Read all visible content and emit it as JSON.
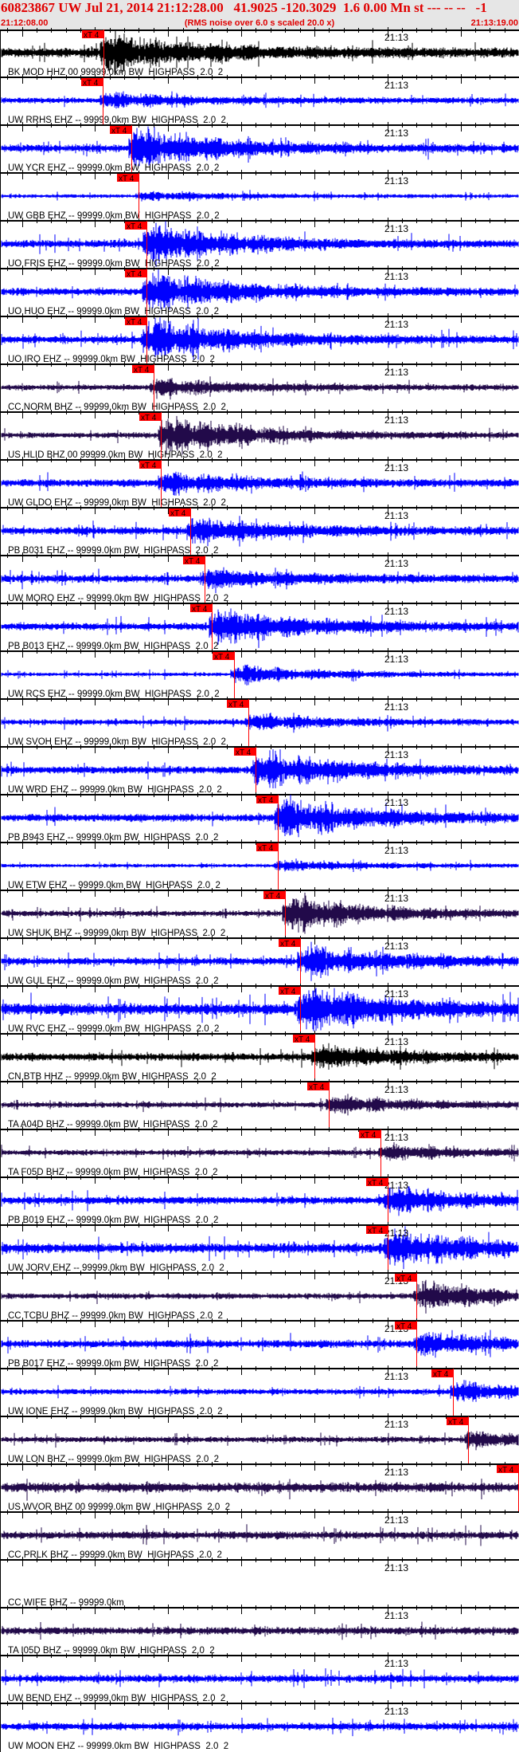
{
  "header": {
    "title": "60823867 UW Jul 21, 2014 21:12:28.00   41.9025 -120.3029  1.6 0.00 Mn st --- -- --   -1",
    "start_time": "21:12:08.00",
    "end_time": "21:13:19.00",
    "note": "(RMS noise over 6.0 s scaled 20.0 x)"
  },
  "time_axis": {
    "span_s": 71,
    "major_label": "21:13",
    "major_label_s": 52
  },
  "pick_label": "xT 4",
  "colors": {
    "header_text": "#e00000",
    "pick": "#ff0000",
    "header_bg": "#e6e6e6"
  },
  "traces": [
    {
      "label": "BK MOD HHZ 00 99999.0km BW  HIGHPASS  2.0  2",
      "color": "#000000",
      "pick_s": 14.2,
      "noise": 5,
      "amp": 28
    },
    {
      "label": "UW RRHS EHZ -- 99999.0km BW  HIGHPASS  2.0  2",
      "color": "#0000ff",
      "pick_s": 14.1,
      "noise": 3,
      "amp": 10
    },
    {
      "label": "UW YCR EHZ -- 99999.0km BW  HIGHPASS  2.0  2",
      "color": "#0000ff",
      "pick_s": 18.0,
      "noise": 4,
      "amp": 30
    },
    {
      "label": "UW GBB EHZ -- 99999.0km BW  HIGHPASS  2.0  2",
      "color": "#0000ff",
      "pick_s": 19.0,
      "noise": 2,
      "amp": 6
    },
    {
      "label": "UO FRIS EHZ -- 99999.0km BW  HIGHPASS  2.0  2",
      "color": "#0000ff",
      "pick_s": 20.0,
      "noise": 4,
      "amp": 30
    },
    {
      "label": "UO HUO EHZ -- 99999.0km BW  HIGHPASS  2.0  2",
      "color": "#0000ff",
      "pick_s": 20.0,
      "noise": 4,
      "amp": 30
    },
    {
      "label": "UO IRO EHZ -- 99999.0km BW  HIGHPASS  2.0  2",
      "color": "#0000ff",
      "pick_s": 20.0,
      "noise": 4,
      "amp": 30
    },
    {
      "label": "CC NORM BHZ -- 99999.0km BW  HIGHPASS  2.0  2",
      "color": "#220a4a",
      "pick_s": 21.0,
      "noise": 3,
      "amp": 12
    },
    {
      "label": "US HLID BHZ 00 99999.0km BW  HIGHPASS  2.0  2",
      "color": "#220a4a",
      "pick_s": 22.0,
      "noise": 3,
      "amp": 30
    },
    {
      "label": "UW GLDO EHZ -- 99999.0km BW  HIGHPASS  2.0  2",
      "color": "#0000ff",
      "pick_s": 22.0,
      "noise": 4,
      "amp": 14
    },
    {
      "label": "PB B031 EHZ -- 99999.0km BW  HIGHPASS  2.0  2",
      "color": "#0000ff",
      "pick_s": 26.0,
      "noise": 4,
      "amp": 18
    },
    {
      "label": "UW MORO EHZ -- 99999.0km BW  HIGHPASS  2.0  2",
      "color": "#0000ff",
      "pick_s": 28.0,
      "noise": 4,
      "amp": 14
    },
    {
      "label": "PB B013 EHZ -- 99999.0km BW  HIGHPASS  2.0  2",
      "color": "#0000ff",
      "pick_s": 29.0,
      "noise": 4,
      "amp": 28
    },
    {
      "label": "UW RCS EHZ -- 99999.0km BW  HIGHPASS  2.0  2",
      "color": "#0000ff",
      "pick_s": 32.0,
      "noise": 2,
      "amp": 14
    },
    {
      "label": "UW SVOH EHZ -- 99999.0km BW  HIGHPASS  2.0  2",
      "color": "#0000ff",
      "pick_s": 34.0,
      "noise": 3,
      "amp": 10
    },
    {
      "label": "UW WRD EHZ -- 99999.0km BW  HIGHPASS  2.0  2",
      "color": "#0000ff",
      "pick_s": 35.0,
      "noise": 4,
      "amp": 28
    },
    {
      "label": "PB B943 EHZ -- 99999.0km BW  HIGHPASS  2.0  2",
      "color": "#0000ff",
      "pick_s": 38.0,
      "noise": 4,
      "amp": 30
    },
    {
      "label": "UW ETW EHZ -- 99999.0km BW  HIGHPASS  2.0  2",
      "color": "#0000ff",
      "pick_s": 38.0,
      "noise": 2,
      "amp": 8
    },
    {
      "label": "UW SHUK BHZ -- 99999.0km BW  HIGHPASS  2.0  2",
      "color": "#220a4a",
      "pick_s": 39.0,
      "noise": 3,
      "amp": 28
    },
    {
      "label": "UW GUL EHZ -- 99999.0km BW  HIGHPASS  2.0  2",
      "color": "#0000ff",
      "pick_s": 41.1,
      "noise": 4,
      "amp": 24
    },
    {
      "label": "UW RVC EHZ -- 99999.0km BW  HIGHPASS  2.0  2",
      "color": "#0000ff",
      "pick_s": 41.1,
      "noise": 6,
      "amp": 32
    },
    {
      "label": "CN BTB HHZ -- 99999.0km BW  HIGHPASS  2.0  2",
      "color": "#000000",
      "pick_s": 43.0,
      "noise": 4,
      "amp": 16
    },
    {
      "label": "TA A04D BHZ -- 99999.0km BW  HIGHPASS  2.0  2",
      "color": "#220a4a",
      "pick_s": 45.0,
      "noise": 3,
      "amp": 12
    },
    {
      "label": "TA F05D BHZ -- 99999.0km BW  HIGHPASS  2.0  2",
      "color": "#220a4a",
      "pick_s": 52.1,
      "noise": 3,
      "amp": 10
    },
    {
      "label": "PB B019 EHZ -- 99999.0km BW  HIGHPASS  2.0  2",
      "color": "#0000ff",
      "pick_s": 53.0,
      "noise": 4,
      "amp": 18
    },
    {
      "label": "UW JORV EHZ -- 99999.0km BW  HIGHPASS  2.0  2",
      "color": "#0000ff",
      "pick_s": 53.0,
      "noise": 5,
      "amp": 26
    },
    {
      "label": "CC TCBU BHZ -- 99999.0km BW  HIGHPASS  2.0  2",
      "color": "#220a4a",
      "pick_s": 57.0,
      "noise": 3,
      "amp": 22
    },
    {
      "label": "PB B017 EHZ -- 99999.0km BW  HIGHPASS  2.0  2",
      "color": "#0000ff",
      "pick_s": 57.0,
      "noise": 4,
      "amp": 16
    },
    {
      "label": "UW IONE EHZ -- 99999.0km BW  HIGHPASS  2.0  2",
      "color": "#0000ff",
      "pick_s": 62.0,
      "noise": 3,
      "amp": 14
    },
    {
      "label": "UW LON BHZ -- 99999.0km BW  HIGHPASS  2.0  2",
      "color": "#220a4a",
      "pick_s": 64.0,
      "noise": 3,
      "amp": 12
    },
    {
      "label": "US WVOR BHZ 00 99999.0km BW  HIGHPASS  2.0  2",
      "color": "#220a4a",
      "pick_s": 71.0,
      "noise": 5,
      "amp": 0
    },
    {
      "label": "CC PRLK BHZ -- 99999.0km BW  HIGHPASS  2.0  2",
      "color": "#220a4a",
      "pick_s": null,
      "noise": 4,
      "amp": 0
    },
    {
      "label": "CC WIFE BHZ -- 99999.0km",
      "color": "#220a4a",
      "pick_s": null,
      "noise": 0,
      "amp": 0
    },
    {
      "label": "TA I05D BHZ -- 99999.0km BW  HIGHPASS  2.0  2",
      "color": "#220a4a",
      "pick_s": null,
      "noise": 4,
      "amp": 0
    },
    {
      "label": "UW BEND EHZ -- 99999.0km BW  HIGHPASS  2.0  2",
      "color": "#0000ff",
      "pick_s": null,
      "noise": 4,
      "amp": 0
    },
    {
      "label": "UW MOON EHZ -- 99999.0km BW  HIGHPASS  2.0  2",
      "color": "#0000ff",
      "pick_s": null,
      "noise": 4,
      "amp": 0
    }
  ]
}
